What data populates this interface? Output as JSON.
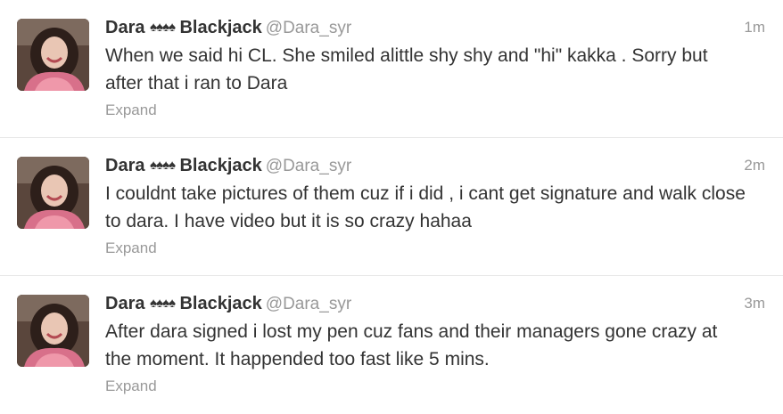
{
  "tweets": [
    {
      "name_first": "Dara",
      "name_spades": "♠♠♠♠",
      "name_last": "Blackjack",
      "username": "@Dara_syr",
      "time": "1m",
      "text": "When we said hi CL. She smiled alittle shy shy and \"hi\" kakka . Sorry but after that i ran to Dara",
      "expand": "Expand",
      "avatar_icon": "profile-photo"
    },
    {
      "name_first": "Dara",
      "name_spades": "♠♠♠♠",
      "name_last": "Blackjack",
      "username": "@Dara_syr",
      "time": "2m",
      "text": "I couldnt take pictures of them cuz if i did , i cant get signature and walk close to dara. I have video but it is so crazy hahaa",
      "expand": "Expand",
      "avatar_icon": "profile-photo"
    },
    {
      "name_first": "Dara",
      "name_spades": "♠♠♠♠",
      "name_last": "Blackjack",
      "username": "@Dara_syr",
      "time": "3m",
      "text": "After dara signed i lost my pen cuz fans and their managers gone crazy at the moment. It happended too fast like 5 mins.",
      "expand": "Expand",
      "avatar_icon": "profile-photo"
    }
  ],
  "colors": {
    "text": "#333333",
    "muted": "#999999",
    "divider": "#e8e8e8",
    "background": "#ffffff"
  }
}
